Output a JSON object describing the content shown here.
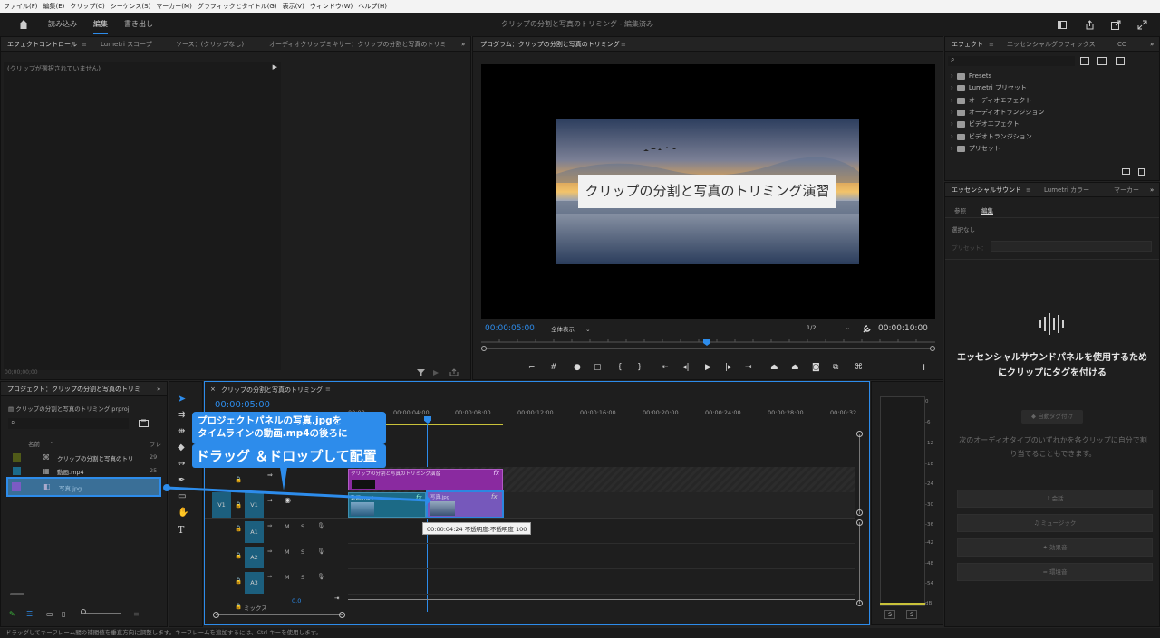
{
  "menu": [
    "ファイル(F)",
    "編集(E)",
    "クリップ(C)",
    "シーケンス(S)",
    "マーカー(M)",
    "グラフィックとタイトル(G)",
    "表示(V)",
    "ウィンドウ(W)",
    "ヘルプ(H)"
  ],
  "workspace": {
    "tabs": [
      "読み込み",
      "編集",
      "書き出し"
    ],
    "title": "クリップの分割と写真のトリミング - 編集済み"
  },
  "source_panel": {
    "tabs": [
      "エフェクトコントロール",
      "Lumetri スコープ",
      "ソース：(クリップなし)",
      "オーディオクリップミキサー：クリップの分割と写真のトリミ"
    ],
    "empty": "(クリップが選択されていません)",
    "timecode": "00;00;00;00"
  },
  "program": {
    "tab": "プログラム：クリップの分割と写真のトリミング",
    "overlay_title": "クリップの分割と写真のトリミング演習",
    "timecode": "00:00:05:00",
    "fit": "全体表示",
    "resolution": "1/2",
    "duration": "00:00:10:00"
  },
  "effects": {
    "tabs": [
      "エフェクト",
      "エッセンシャルグラフィックス",
      "CC"
    ],
    "items": [
      "Presets",
      "Lumetri プリセット",
      "オーディオエフェクト",
      "オーディオトランジション",
      "ビデオエフェクト",
      "ビデオトランジション",
      "プリセット"
    ]
  },
  "sound": {
    "tabs": [
      "エッセンシャルサウンド",
      "Lumetri カラー",
      "マーカー"
    ],
    "subtabs": [
      "参照",
      "編集"
    ],
    "none": "選択なし",
    "preset": "プリセット：",
    "tag_msg": "エッセンシャルサウンドパネルを使用するためにクリップにタグを付ける",
    "auto_tag": "自動タグ付け",
    "desc": "次のオーディオタイプのいずれかを各クリップに自分で割り当てることもできます。",
    "buttons": [
      "会話",
      "ミュージック",
      "効果音",
      "環境音"
    ]
  },
  "project": {
    "tab": "プロジェクト：クリップの分割と写真のトリミング",
    "file": "クリップの分割と写真のトリミング.prproj",
    "col_name": "名前",
    "col_rate": "フレ",
    "items": [
      {
        "name": "クリップの分割と写真のトリ",
        "rate": "29",
        "color": "#4f5a18"
      },
      {
        "name": "動画.mp4",
        "rate": "25",
        "color": "#1b6a8a"
      },
      {
        "name": "写真.jpg",
        "rate": "",
        "color": "#7b5bc4"
      }
    ]
  },
  "timeline": {
    "tab": "クリップの分割と写真のトリミング",
    "timecode": "00:00:05:00",
    "ruler": [
      "00:00",
      "00:00:04:00",
      "00:00:08:00",
      "00:00:12:00",
      "00:00:16:00",
      "00:00:20:00",
      "00:00:24:00",
      "00:00:28:00",
      "00:00:32"
    ],
    "v1": "V1",
    "v1_src": "V1",
    "audio": [
      "A1",
      "A2",
      "A3"
    ],
    "m": "M",
    "s": "S",
    "mix": "ミックス",
    "mix_val": "0.0",
    "title_clip": "クリップの分割と写真のトリミング演習",
    "video_clip": "動画.mp4",
    "photo_clip": "写真.jpg",
    "tooltip": "00:00:04:24  不透明度:不透明度 100"
  },
  "callout": {
    "line1": "プロジェクトパネルの写真.jpgを",
    "line2": "タイムラインの動画.mp4の後ろに",
    "line3": "ドラッグ ＆ドロップして配置"
  },
  "meter": {
    "ticks": [
      "0",
      "-6",
      "-12",
      "-18",
      "-24",
      "-30",
      "-36",
      "-42",
      "-48",
      "-54",
      "dB"
    ],
    "s": "S"
  },
  "status": "ドラッグしてキーフレーム間の補間値を垂直方向に調整します。キーフレームを追加するには、Ctrl キーを使用します。",
  "colors": {
    "accent": "#2d8ceb",
    "callout": "#2d8ceb",
    "title_clip": "#8a2aa0",
    "video_clip": "#1c6a86",
    "photo_clip": "#7b5bc4"
  }
}
